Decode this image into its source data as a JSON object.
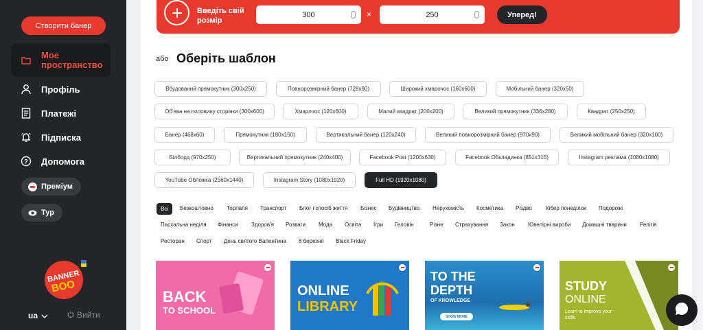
{
  "sidebar": {
    "create_button": "Створити банер",
    "nav": [
      {
        "label": "Мое пространство",
        "icon": "folder-icon"
      },
      {
        "label": "Профіль",
        "icon": "user-icon"
      },
      {
        "label": "Платежі",
        "icon": "receipt-icon"
      },
      {
        "label": "Підписка",
        "icon": "alarm-icon"
      },
      {
        "label": "Допомога",
        "icon": "help-icon"
      }
    ],
    "premium_label": "Преміум",
    "tour_label": "Тур",
    "logo_text": "BANNER BOO",
    "lang": "ua",
    "logout": "Вийти"
  },
  "size_bar": {
    "label": "Введіть свій розмір",
    "width_value": "300",
    "height_value": "250",
    "times": "×",
    "go_button": "Уперед!"
  },
  "templates": {
    "or_label": "або",
    "title": "Оберіть шаблон",
    "items": [
      "Вбудований прямокутник (300x250)",
      "Повнорозмірний банер (728x90)",
      "Широкий хмарочос (160x600)",
      "Мобільний банер (320x50)",
      "Об'ява на половину сторінки (300x600)",
      "Хмарочос (120x600)",
      "Малий квадрат (200x200)",
      "Великий прямокутник (336x280)",
      "Квадрат (250x250)",
      "Банер (468x60)",
      "Прямокутник (180x150)",
      "Вертикальний банер (120x240)",
      "Великий повнорозмірний банер (970x90)",
      "Великий мобільний банер (320x100)",
      "Білборд (970x250)",
      "Вертикальний прямокутник (240x400)",
      "Facebook Post (1200x630)",
      "Facebook Обкладинка (851x315)",
      "Instagram реклама (1080x1080)",
      "YouTube Обложка (2560x1440)",
      "Instagram Story (1080x1920)",
      "Full HD (1920x1080)"
    ],
    "selected": "Full HD (1920x1080)"
  },
  "categories": {
    "items": [
      "Всі",
      "Безкоштовно",
      "Торгівля",
      "Транспорт",
      "Блог і спосіб життя",
      "Бізнес",
      "Будівництво",
      "Нерухомість",
      "Косметика",
      "Різдво",
      "Кібер понеділок",
      "Подорожі",
      "Пасхальна неділя",
      "Фінанси",
      "Здоров'я",
      "Розваги",
      "Мода",
      "Освіта",
      "Ігри",
      "Геловін",
      "Різне",
      "Страхування",
      "Закон",
      "Ювелірні вироби",
      "Домашні тварини",
      "Релігія",
      "Ресторан",
      "Спорт",
      "День святого Валентина",
      "8 березня",
      "Black Friday"
    ],
    "selected": "Всі"
  },
  "cards": [
    {
      "line1": "BACK",
      "line2": "TO SCHOOL",
      "bg": "#f06ba8"
    },
    {
      "line1": "ONLINE",
      "line2": "LIBRARY",
      "bg": "#1f78c8"
    },
    {
      "line1": "TO THE",
      "line2": "DEPTH",
      "line3": "OF KNOWLEDGE",
      "button": "SHOW MORE",
      "bg": "#2c8fc9"
    },
    {
      "line1": "STUDY",
      "line2": "ONLINE",
      "line3": "Learn to improve your skills",
      "bg": "#a3b52e"
    }
  ],
  "colors": {
    "accent": "#e8392f",
    "sidebar": "#252629",
    "dark_button": "#252629"
  }
}
